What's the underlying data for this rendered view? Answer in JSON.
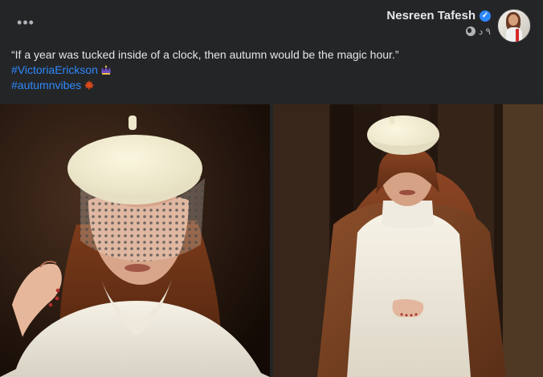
{
  "post": {
    "author_name": "Nesreen Tafesh",
    "timestamp": "٩ د",
    "more_label": "•••",
    "caption_text": "“If a year was tucked inside of a clock, then autumn would be the magic hour.”",
    "hashtag_1": "#VictoriaErickson",
    "hashtag_2": "#autumnvibes"
  },
  "icons": {
    "verified": "verified-badge-icon",
    "audience": "globe-icon",
    "emoji_1": "crown-emoji",
    "emoji_2": "maple-leaf-emoji"
  },
  "colors": {
    "background": "#242526",
    "text": "#e4e6eb",
    "secondary_text": "#b0b3b8",
    "link": "#2e89ff",
    "verified": "#2d88ff"
  }
}
